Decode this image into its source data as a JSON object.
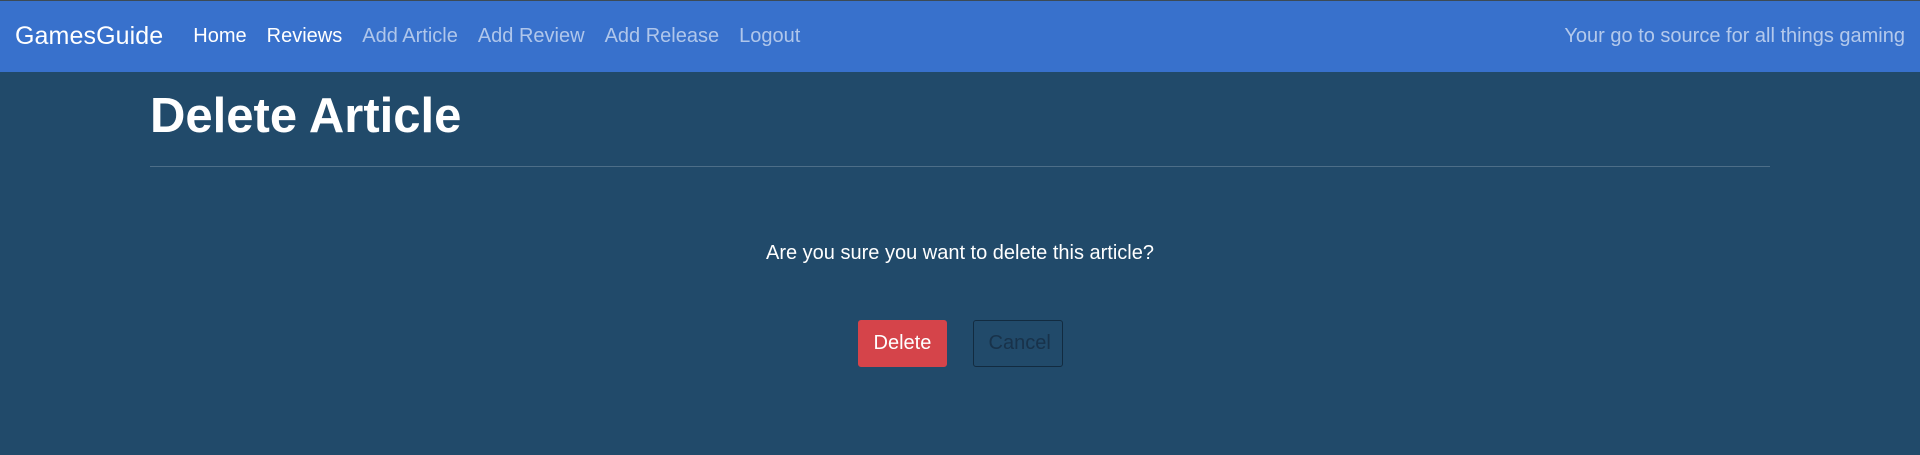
{
  "navbar": {
    "brand": "GamesGuide",
    "tagline": "Your go to source for all things gaming",
    "links": [
      {
        "label": "Home",
        "active": true
      },
      {
        "label": "Reviews",
        "active": true
      },
      {
        "label": "Add Article",
        "active": false
      },
      {
        "label": "Add Review",
        "active": false
      },
      {
        "label": "Add Release",
        "active": false
      },
      {
        "label": "Logout",
        "active": false
      }
    ]
  },
  "page": {
    "title": "Delete Article",
    "confirm_text": "Are you sure you want to delete this article?"
  },
  "actions": {
    "delete_label": "Delete",
    "cancel_label": "Cancel"
  },
  "colors": {
    "navbar_bg": "#3871cc",
    "page_bg": "#214a6a",
    "danger": "#d5444a"
  }
}
